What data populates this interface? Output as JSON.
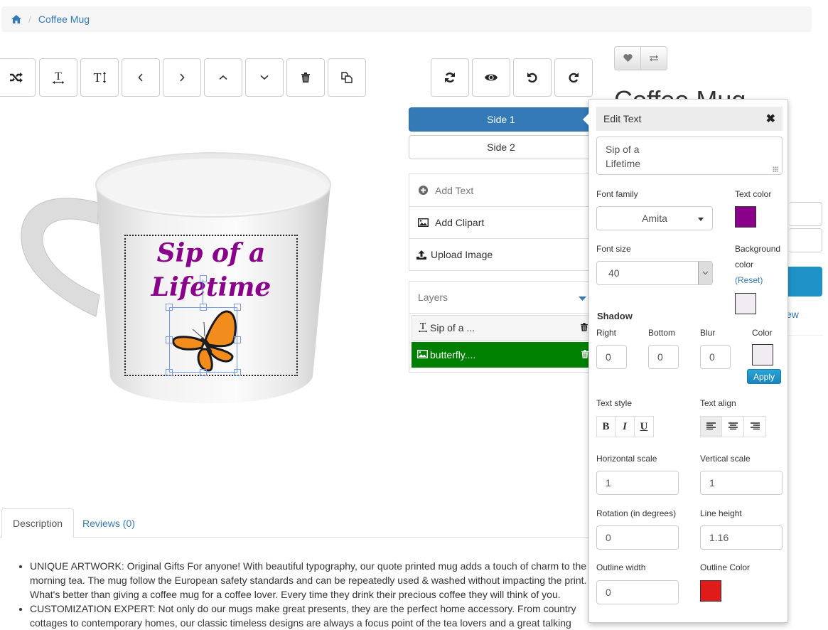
{
  "breadcrumb": {
    "home_icon": "home-icon",
    "current": "Coffee Mug"
  },
  "toolbar_left": [
    {
      "name": "shuffle",
      "icon": "shuffle-icon"
    },
    {
      "name": "text-width",
      "icon": "text-width-icon"
    },
    {
      "name": "text-height",
      "icon": "text-height-icon"
    },
    {
      "name": "move-left",
      "icon": "chevron-left-icon"
    },
    {
      "name": "move-right",
      "icon": "chevron-right-icon"
    },
    {
      "name": "move-up",
      "icon": "chevron-up-icon"
    },
    {
      "name": "move-down",
      "icon": "chevron-down-icon"
    },
    {
      "name": "delete",
      "icon": "trash-icon"
    },
    {
      "name": "duplicate",
      "icon": "copy-icon"
    }
  ],
  "toolbar_right": [
    {
      "name": "refresh",
      "icon": "refresh-icon"
    },
    {
      "name": "preview",
      "icon": "eye-icon"
    },
    {
      "name": "undo",
      "icon": "undo-icon"
    },
    {
      "name": "redo",
      "icon": "redo-icon"
    }
  ],
  "product": {
    "title": "Coffee Mug",
    "wishlist_icon": "heart-icon",
    "compare_icon": "exchange-icon",
    "review_link_fragment": "ew"
  },
  "sides": {
    "side1": "Side 1",
    "side2": "Side 2"
  },
  "actions": {
    "add_text": "Add Text",
    "add_clipart": "Add Clipart",
    "upload_image": "Upload Image"
  },
  "layers": {
    "title": "Layers",
    "items": [
      {
        "type": "text",
        "label": "Sip of a ..."
      },
      {
        "type": "image",
        "label": "butterfly...."
      }
    ]
  },
  "canvas": {
    "text_line1": "Sip of a",
    "text_line2": "Lifetime",
    "text_color": "#8b008b"
  },
  "tabs": {
    "description": "Description",
    "reviews": "Reviews (0)"
  },
  "description": {
    "items": [
      "UNIQUE ARTWORK: Original Gifts For anyone! With beautiful typography, our quote printed mug adds a touch of charm to the morning tea. The mug follow the European safety standards and can be repeatedly used & washed without impacting the print. What's better than giving a coffee mug for a coffee lover. Every time they drink their precious coffee they will think of you.",
      "CUSTOMIZATION EXPERT: Not only do our mugs make great presents, they are the perfect home accessory. From country cottages to contemporary homes, our classic timeless designs are always a focus point of the tea lovers and a great talking"
    ]
  },
  "edit_text": {
    "title": "Edit Text",
    "text_value": "Sip of a\nLifetime",
    "font_family_label": "Font family",
    "font_family_value": "Amita",
    "text_color_label": "Text color",
    "text_color": "#8b008b",
    "font_size_label": "Font size",
    "font_size_value": "40",
    "bg_color_label_1": "Background",
    "bg_color_label_2": "color",
    "bg_reset": "(Reset)",
    "bg_color": "#f0ecf2",
    "shadow_title": "Shadow",
    "shadow_right_label": "Right",
    "shadow_right": "0",
    "shadow_bottom_label": "Bottom",
    "shadow_bottom": "0",
    "shadow_blur_label": "Blur",
    "shadow_blur": "0",
    "shadow_color_label": "Color",
    "shadow_color": "#f0ecf2",
    "apply": "Apply",
    "text_style_label": "Text style",
    "bold": "B",
    "italic": "I",
    "underline": "U",
    "text_align_label": "Text align",
    "text_align_active": "left",
    "h_scale_label": "Horizontal scale",
    "h_scale": "1",
    "v_scale_label": "Vertical scale",
    "v_scale": "1",
    "rotation_label": "Rotation (in degrees)",
    "rotation": "0",
    "line_height_label": "Line height",
    "line_height": "1.16",
    "outline_width_label": "Outline width",
    "outline_width": "0",
    "outline_color_label": "Outline Color",
    "outline_color": "#e01b1b"
  }
}
